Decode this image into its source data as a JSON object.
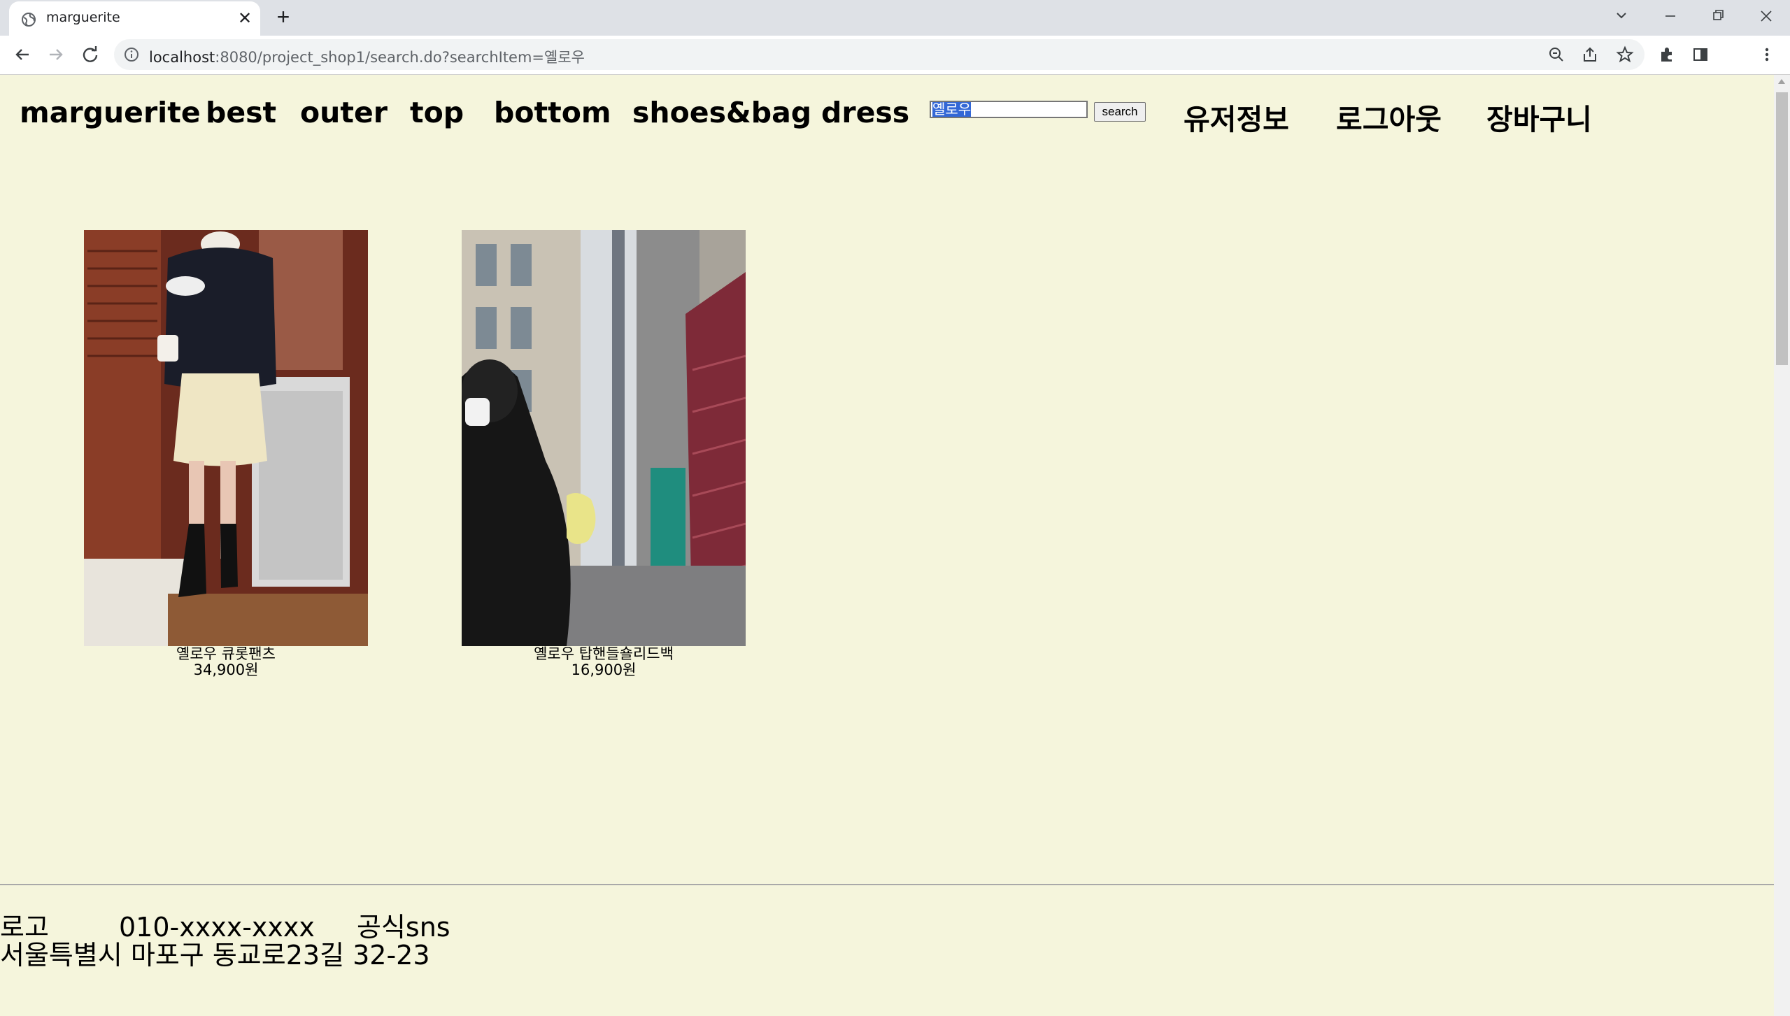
{
  "browser": {
    "tab_title": "marguerite",
    "url_host": "localhost",
    "url_rest": ":8080/project_shop1/search.do?searchItem=옐로우"
  },
  "nav": {
    "brand": "marguerite",
    "links": [
      "best",
      "outer",
      "top",
      "bottom",
      "shoes&bag",
      "dress"
    ],
    "user_links": [
      "유저정보",
      "로그아웃",
      "장바구니"
    ]
  },
  "search": {
    "value": "옐로우",
    "button_label": "search"
  },
  "products": [
    {
      "name": "옐로우 큐롯팬츠",
      "price": "34,900원"
    },
    {
      "name": "옐로우 탑핸들숄리드백",
      "price": "16,900원"
    }
  ],
  "footer": {
    "logo": "로고",
    "phone": "010-xxxx-xxxx",
    "sns": "공식sns",
    "address": "서울특별시 마포구 동교로23길 32-23"
  },
  "colors": {
    "page_background": "#f5f5dc",
    "selection": "#3367d6"
  }
}
